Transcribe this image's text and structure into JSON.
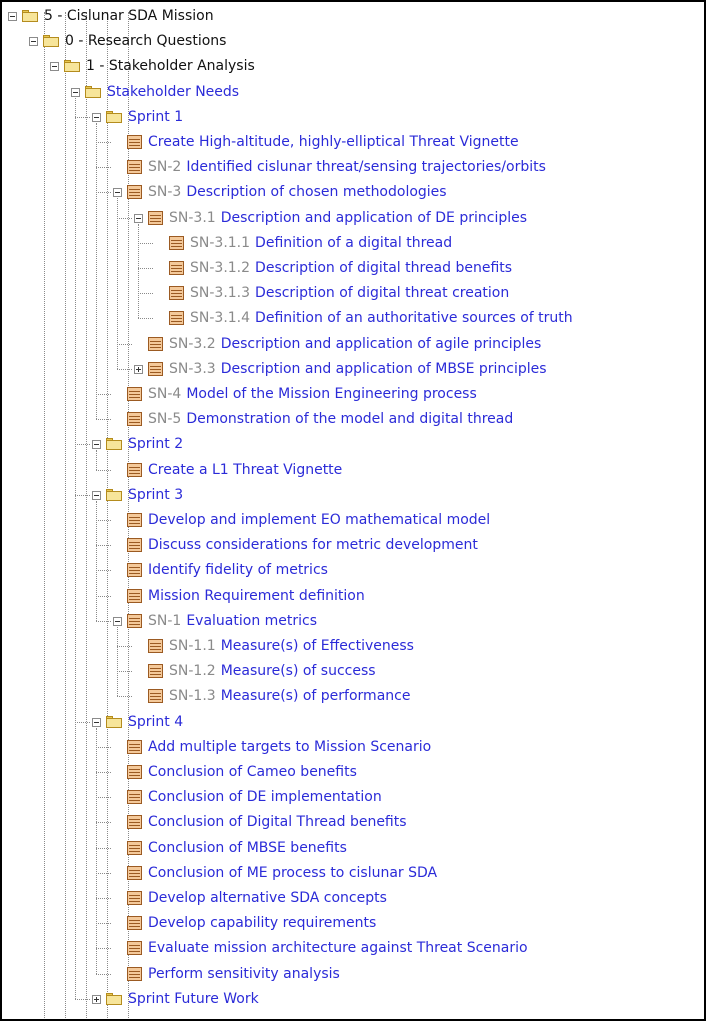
{
  "tree": [
    {
      "label": "5 - Cislunar SDA Mission",
      "level": 0,
      "icon": "folder",
      "toggle": "minus",
      "top": true
    },
    {
      "label": "0 - Research Questions",
      "level": 1,
      "icon": "folder",
      "toggle": "minus",
      "top": true
    },
    {
      "label": "1 - Stakeholder Analysis",
      "level": 2,
      "icon": "folder",
      "toggle": "minus",
      "top": true
    },
    {
      "label": "Stakeholder Needs",
      "level": 3,
      "icon": "folder",
      "toggle": "minus"
    },
    {
      "label": "Sprint 1",
      "level": 4,
      "icon": "folder",
      "toggle": "minus"
    },
    {
      "label": "Create High-altitude, highly-elliptical Threat Vignette",
      "level": 5,
      "icon": "requirement"
    },
    {
      "id": "SN-2",
      "label": "Identified cislunar threat/sensing trajectories/orbits",
      "level": 5,
      "icon": "requirement"
    },
    {
      "id": "SN-3",
      "label": "Description of chosen methodologies",
      "level": 5,
      "icon": "requirement",
      "toggle": "minus"
    },
    {
      "id": "SN-3.1",
      "label": "Description and application of DE principles",
      "level": 6,
      "icon": "requirement",
      "toggle": "minus"
    },
    {
      "id": "SN-3.1.1",
      "label": "Definition of a digital thread",
      "level": 7,
      "icon": "requirement"
    },
    {
      "id": "SN-3.1.2",
      "label": "Description of digital thread benefits",
      "level": 7,
      "icon": "requirement"
    },
    {
      "id": "SN-3.1.3",
      "label": "Description of digital threat creation",
      "level": 7,
      "icon": "requirement"
    },
    {
      "id": "SN-3.1.4",
      "label": "Definition of an authoritative sources of truth",
      "level": 7,
      "icon": "requirement"
    },
    {
      "id": "SN-3.2",
      "label": "Description and application of agile principles",
      "level": 6,
      "icon": "requirement"
    },
    {
      "id": "SN-3.3",
      "label": "Description and application of MBSE principles",
      "level": 6,
      "icon": "requirement",
      "toggle": "plus"
    },
    {
      "id": "SN-4",
      "label": "Model of the Mission Engineering process",
      "level": 5,
      "icon": "requirement"
    },
    {
      "id": "SN-5",
      "label": "Demonstration of the model and digital thread",
      "level": 5,
      "icon": "requirement"
    },
    {
      "label": "Sprint 2",
      "level": 4,
      "icon": "folder",
      "toggle": "minus"
    },
    {
      "label": "Create a L1 Threat Vignette",
      "level": 5,
      "icon": "requirement"
    },
    {
      "label": "Sprint 3",
      "level": 4,
      "icon": "folder",
      "toggle": "minus"
    },
    {
      "label": "Develop and implement EO mathematical model",
      "level": 5,
      "icon": "requirement"
    },
    {
      "label": "Discuss considerations for metric development",
      "level": 5,
      "icon": "requirement"
    },
    {
      "label": "Identify fidelity of metrics",
      "level": 5,
      "icon": "requirement"
    },
    {
      "label": "Mission Requirement definition",
      "level": 5,
      "icon": "requirement"
    },
    {
      "id": "SN-1",
      "label": "Evaluation metrics",
      "level": 5,
      "icon": "requirement",
      "toggle": "minus"
    },
    {
      "id": "SN-1.1",
      "label": "Measure(s) of Effectiveness",
      "level": 6,
      "icon": "requirement"
    },
    {
      "id": "SN-1.2",
      "label": "Measure(s) of success",
      "level": 6,
      "icon": "requirement"
    },
    {
      "id": "SN-1.3",
      "label": "Measure(s) of performance",
      "level": 6,
      "icon": "requirement"
    },
    {
      "label": "Sprint 4",
      "level": 4,
      "icon": "folder",
      "toggle": "minus"
    },
    {
      "label": "Add multiple targets to Mission Scenario",
      "level": 5,
      "icon": "requirement"
    },
    {
      "label": "Conclusion of Cameo benefits",
      "level": 5,
      "icon": "requirement"
    },
    {
      "label": "Conclusion of DE implementation",
      "level": 5,
      "icon": "requirement"
    },
    {
      "label": "Conclusion of Digital Thread benefits",
      "level": 5,
      "icon": "requirement"
    },
    {
      "label": "Conclusion of MBSE benefits",
      "level": 5,
      "icon": "requirement"
    },
    {
      "label": "Conclusion of ME process to cislunar SDA",
      "level": 5,
      "icon": "requirement"
    },
    {
      "label": "Develop alternative SDA concepts",
      "level": 5,
      "icon": "requirement"
    },
    {
      "label": "Develop capability requirements",
      "level": 5,
      "icon": "requirement"
    },
    {
      "label": "Evaluate mission architecture against Threat Scenario",
      "level": 5,
      "icon": "requirement"
    },
    {
      "label": "Perform sensitivity analysis",
      "level": 5,
      "icon": "requirement"
    },
    {
      "label": "Sprint Future Work",
      "level": 4,
      "icon": "folder",
      "toggle": "plus"
    }
  ]
}
